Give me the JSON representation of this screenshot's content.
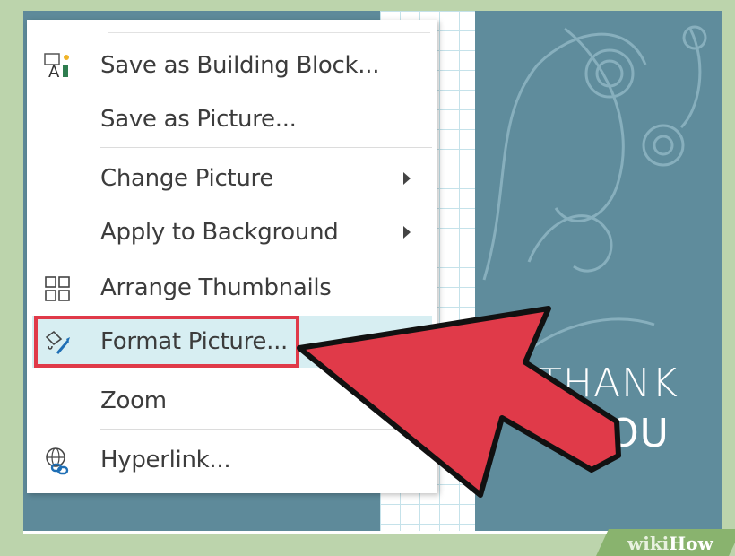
{
  "menu": {
    "items": [
      {
        "label": "Save as Building Block...",
        "icon": "building-block-icon",
        "submenu": false
      },
      {
        "label": "Save as Picture...",
        "icon": "",
        "submenu": false
      },
      {
        "label": "Change Picture",
        "icon": "",
        "submenu": true
      },
      {
        "label": "Apply to Background",
        "icon": "",
        "submenu": true
      },
      {
        "label": "Arrange Thumbnails",
        "icon": "thumbnails-icon",
        "submenu": false
      },
      {
        "label": "Format Picture...",
        "icon": "format-picture-icon",
        "submenu": false
      },
      {
        "label": "Zoom",
        "icon": "",
        "submenu": false
      },
      {
        "label": "Hyperlink...",
        "icon": "hyperlink-icon",
        "submenu": false
      }
    ]
  },
  "card": {
    "line1": "THANK",
    "line2": "OU"
  },
  "watermark": {
    "wiki": "wiki",
    "how": "How"
  },
  "colors": {
    "card_teal": "#5f8c9c",
    "highlight": "#d7eef2",
    "annotation_red": "#e03a49",
    "frame_green": "#bcd4ac"
  }
}
